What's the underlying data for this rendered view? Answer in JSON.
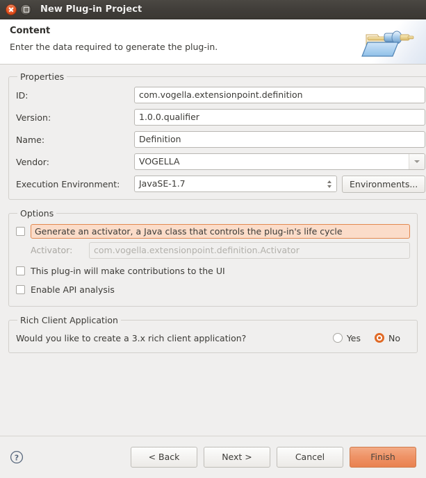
{
  "window": {
    "title": "New Plug-in Project",
    "close_icon": "close-icon",
    "maximize_icon": "maximize-icon"
  },
  "header": {
    "title": "Content",
    "description": "Enter the data required to generate the plug-in.",
    "banner_icon": "plugin-folder-banner-icon"
  },
  "properties": {
    "legend": "Properties",
    "fields": [
      {
        "label": "ID:",
        "value": "com.vogella.extensionpoint.definition"
      },
      {
        "label": "Version:",
        "value": "1.0.0.qualifier"
      },
      {
        "label": "Name:",
        "value": "Definition"
      }
    ],
    "vendor": {
      "label": "Vendor:",
      "value": "VOGELLA",
      "arrow_icon": "chevron-down-icon"
    },
    "execution_environment": {
      "label": "Execution Environment:",
      "value": "JavaSE-1.7",
      "up_icon": "spinner-up-icon",
      "down_icon": "spinner-down-icon",
      "button_label": "Environments..."
    }
  },
  "options": {
    "legend": "Options",
    "generate_activator": {
      "label": "Generate an activator, a Java class that controls the plug-in's life cycle",
      "checked": false
    },
    "activator": {
      "label": "Activator:",
      "value": "com.vogella.extensionpoint.definition.Activator",
      "disabled": true
    },
    "ui_contributions": {
      "label": "This plug-in will make contributions to the UI",
      "checked": false
    },
    "api_analysis": {
      "label": "Enable API analysis",
      "checked": false
    }
  },
  "rich_client": {
    "legend": "Rich Client Application",
    "question": "Would you like to create a 3.x rich client application?",
    "yes_label": "Yes",
    "no_label": "No",
    "selected": "No"
  },
  "buttonbar": {
    "help_icon": "help-question-icon",
    "back_label": "< Back",
    "next_label": "Next >",
    "cancel_label": "Cancel",
    "finish_label": "Finish"
  },
  "colors": {
    "titlebar": "#403d39",
    "background": "#f0efee",
    "accent_orange": "#e06a26",
    "focus_highlight_bg": "#fbdcc9",
    "focus_highlight_border": "#e2884f",
    "finish_button": "#ef9468"
  }
}
